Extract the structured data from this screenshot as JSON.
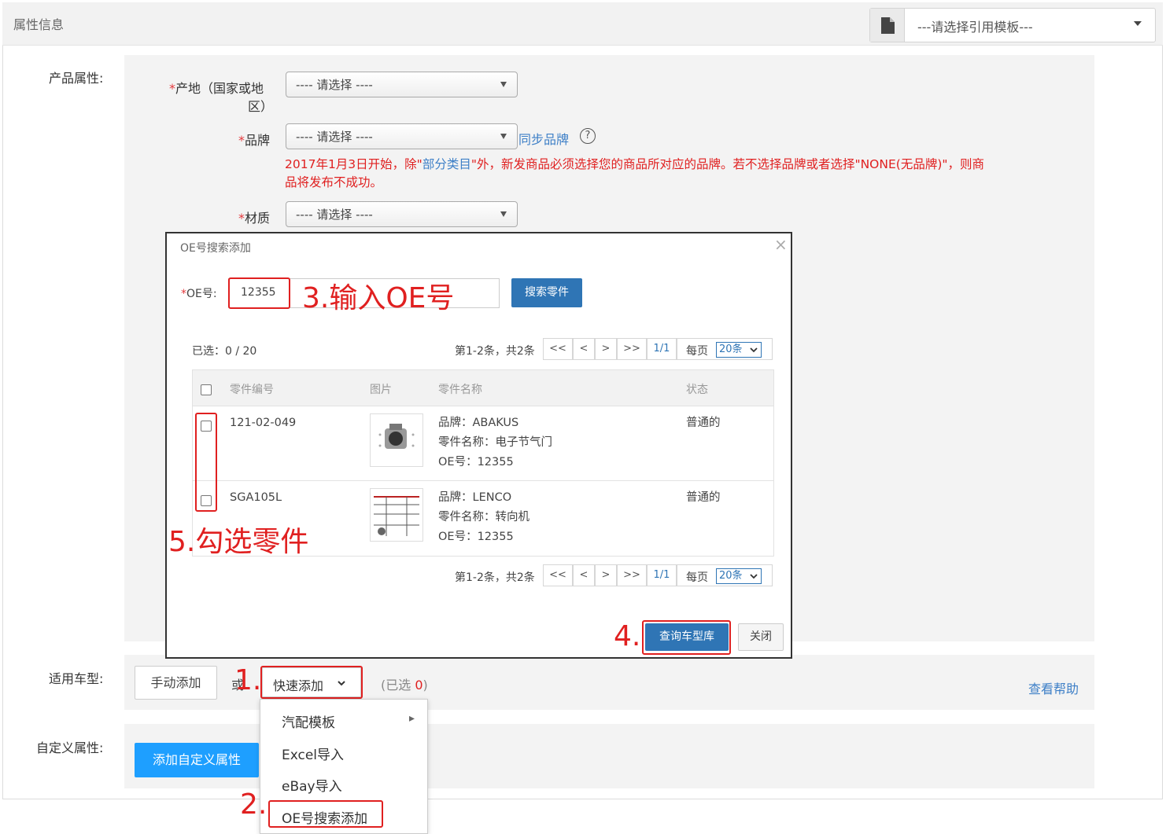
{
  "header": {
    "title": "属性信息",
    "template_placeholder": "---请选择引用模板---"
  },
  "product_attrs": {
    "label": "产品属性:",
    "origin": {
      "label_line1": "产地（国家或地",
      "label_line2": "区）",
      "value": "---- 请选择 ----"
    },
    "brand": {
      "label": "品牌",
      "value": "---- 请选择 ----",
      "sync_link": "同步品牌",
      "help": "?"
    },
    "brand_note_1": "2017年1月3日开始，除\"",
    "brand_note_link": "部分类目",
    "brand_note_2": "\"外，新发商品必须选择您的商品所对应的品牌。若不选择品牌或者选择\"NONE(无品牌)\"，则商",
    "brand_note_3": "品将发布不成功。",
    "material": {
      "label": "材质",
      "value": "---- 请选择 ----"
    },
    "req_mark": "*"
  },
  "vehicle": {
    "label": "适用车型:",
    "manual_btn": "手动添加",
    "or_text": "或",
    "quick_btn": "快速添加",
    "selected_prefix": "(已选 ",
    "selected_count": "0",
    "selected_suffix": ")",
    "help_link": "查看帮助"
  },
  "custom": {
    "label": "自定义属性:",
    "add_btn": "添加自定义属性"
  },
  "menu": {
    "items": [
      "汽配模板",
      "Excel导入",
      "eBay导入",
      "OE号搜索添加"
    ],
    "submenu_arrow": "▸"
  },
  "dialog": {
    "title": "OE号搜索添加",
    "close": "×",
    "oe_label": "OE号:",
    "oe_req": "*",
    "oe_value": "12355",
    "search_btn": "搜索零件",
    "selected": "已选：0 / 20",
    "pager": {
      "range": "第1-2条，共2条",
      "first": "<<",
      "prev": "<",
      "next": ">",
      "last": ">>",
      "page": "1/1",
      "per_page_label": "每页",
      "per_page_value": "20条"
    },
    "columns": [
      "零件编号",
      "图片",
      "零件名称",
      "状态"
    ],
    "rows": [
      {
        "code": "121-02-049",
        "brand": "品牌：ABAKUS",
        "name": "零件名称：电子节气门",
        "oe": "OE号：12355",
        "status": "普通的"
      },
      {
        "code": "SGA105L",
        "brand": "品牌：LENCO",
        "name": "零件名称：转向机",
        "oe": "OE号：12355",
        "status": "普通的"
      }
    ],
    "query_btn": "查询车型库",
    "close_btn": "关闭"
  },
  "annotations": {
    "step1": "1.",
    "step2": "2.",
    "step3": "3.输入OE号",
    "step4": "4.",
    "step5": "5.勾选零件"
  },
  "colors": {
    "accent_blue": "#2f75b5",
    "link_blue": "#3d7fc7",
    "annotation_red": "#e02020",
    "add_button_blue": "#1e9fff"
  }
}
